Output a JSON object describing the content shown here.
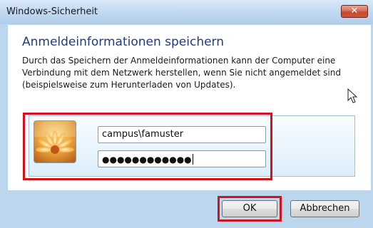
{
  "window": {
    "title": "Windows-Sicherheit",
    "close_symbol": "✕"
  },
  "dialog": {
    "heading": "Anmeldeinformationen speichern",
    "description": "Durch das Speichern der Anmeldeinformationen kann der Computer eine Verbindung mit dem Netzwerk herstellen, wenn Sie nicht angemeldet sind (beispielsweise zum Herunterladen von Updates)."
  },
  "credentials": {
    "username": "campus\\famuster",
    "password_mask": "●●●●●●●●●●●●"
  },
  "buttons": {
    "ok_label": "OK",
    "cancel_label": "Abbrechen"
  },
  "colors": {
    "heading": "#1e3b8a",
    "highlight": "#d0141b",
    "titlebar": "#c3daf1"
  },
  "icons": {
    "user_tile": "flower-user-tile-icon",
    "cursor": "mouse-cursor-icon"
  }
}
